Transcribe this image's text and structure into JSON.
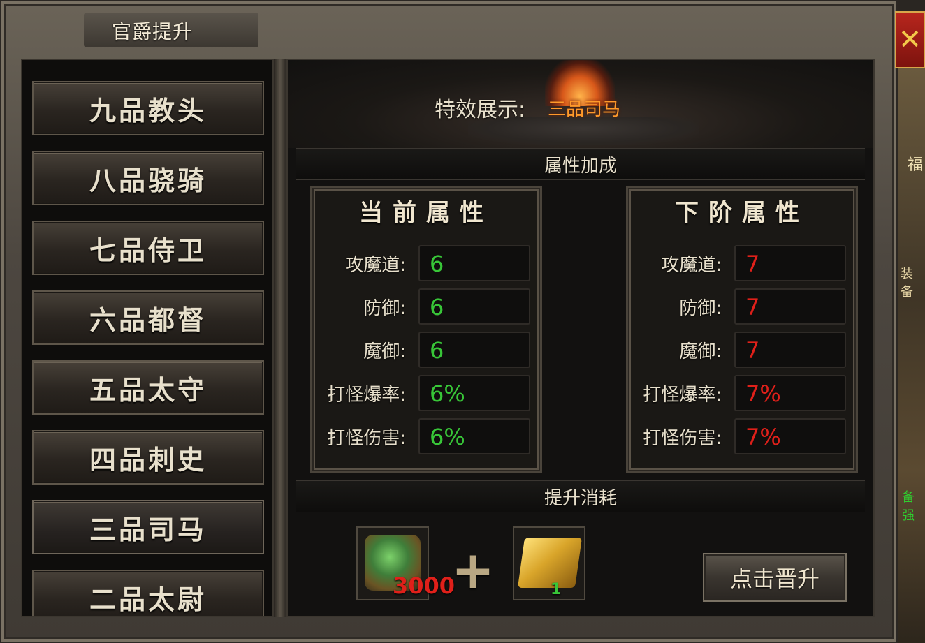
{
  "window": {
    "title": "官爵提升",
    "close_label": "✕"
  },
  "ranks": [
    {
      "label": "九品教头",
      "selected": false
    },
    {
      "label": "八品骁骑",
      "selected": false
    },
    {
      "label": "七品侍卫",
      "selected": false
    },
    {
      "label": "六品都督",
      "selected": false
    },
    {
      "label": "五品太守",
      "selected": false
    },
    {
      "label": "四品刺史",
      "selected": false
    },
    {
      "label": "三品司马",
      "selected": true
    },
    {
      "label": "二品太尉",
      "selected": false
    }
  ],
  "effect": {
    "label": "特效展示:",
    "value": "三品司马"
  },
  "attributes_section": {
    "title": "属性加成"
  },
  "current": {
    "title": "当前属性",
    "rows": [
      {
        "label": "攻魔道:",
        "value": "6"
      },
      {
        "label": "防御:",
        "value": "6"
      },
      {
        "label": "魔御:",
        "value": "6"
      },
      {
        "label": "打怪爆率:",
        "value": "6%"
      },
      {
        "label": "打怪伤害:",
        "value": "6%"
      }
    ]
  },
  "next": {
    "title": "下阶属性",
    "rows": [
      {
        "label": "攻魔道:",
        "value": "7"
      },
      {
        "label": "防御:",
        "value": "7"
      },
      {
        "label": "魔御:",
        "value": "7"
      },
      {
        "label": "打怪爆率:",
        "value": "7%"
      },
      {
        "label": "打怪伤害:",
        "value": "7%"
      }
    ]
  },
  "cost_section": {
    "title": "提升消耗",
    "items": [
      {
        "name": "token",
        "count": "3000"
      },
      {
        "name": "gold",
        "count": "1"
      }
    ],
    "plus": "+"
  },
  "promote_button": {
    "label": "点击晋升"
  },
  "side": {
    "t1": "福",
    "t2": "装备",
    "t3": "备强"
  },
  "colors": {
    "current_value": "#38c638",
    "next_value": "#e0201a",
    "effect_value": "#ff9a2a"
  }
}
